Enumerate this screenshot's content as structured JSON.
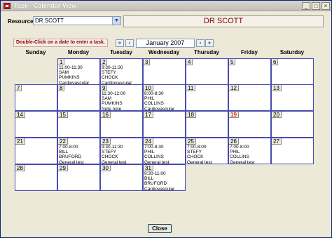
{
  "window": {
    "title": "Task - Calendar View"
  },
  "resource": {
    "label": "Resource:",
    "selected": "DR SCOTT",
    "display_name": "DR SCOTT"
  },
  "hint": "Double-Click on a date to enter a task.",
  "nav": {
    "first": "«",
    "prev": "‹",
    "month": "January 2007",
    "next": "›",
    "last": "»"
  },
  "weekdays": [
    "Sunday",
    "Monday",
    "Tuesday",
    "Wednesday",
    "Thursday",
    "Friday",
    "Saturday"
  ],
  "weeks": [
    [
      {
        "day": ""
      },
      {
        "day": "1",
        "lines": [
          "11:00-11:30",
          "SAM",
          "PUMKINS",
          "Cardiovascular"
        ]
      },
      {
        "day": "2",
        "lines": [
          "9:30-11:30",
          "STEFY",
          "CHOCK",
          "Cardiovascular"
        ]
      },
      {
        "day": "3"
      },
      {
        "day": "4"
      },
      {
        "day": "5"
      },
      {
        "day": "6"
      }
    ],
    [
      {
        "day": "7"
      },
      {
        "day": "8"
      },
      {
        "day": "9",
        "lines": [
          "11:30-12:00",
          "SAM",
          "PUMKINS",
          "Note note"
        ]
      },
      {
        "day": "10",
        "lines": [
          "8:00-8:30",
          "PHIL",
          "COLLINS",
          "Cardiovascular"
        ]
      },
      {
        "day": "11"
      },
      {
        "day": "12"
      },
      {
        "day": "13"
      }
    ],
    [
      {
        "day": "14"
      },
      {
        "day": "15"
      },
      {
        "day": "16"
      },
      {
        "day": "17"
      },
      {
        "day": "18"
      },
      {
        "day": "19",
        "holiday": true
      },
      {
        "day": "20"
      }
    ],
    [
      {
        "day": "21"
      },
      {
        "day": "22",
        "lines": [
          "7:00-8:00",
          "BILL",
          "BRUFORD",
          "General test"
        ]
      },
      {
        "day": "23",
        "lines": [
          "9:30-11:30",
          "STEFY",
          "CHOCK",
          "General test"
        ]
      },
      {
        "day": "24",
        "lines": [
          "7:00-8:30",
          "PHIL",
          "COLLINS",
          "General test"
        ]
      },
      {
        "day": "25",
        "lines": [
          "7:00-8:00",
          "STEFY",
          "CHOCK",
          "General test"
        ]
      },
      {
        "day": "26",
        "lines": [
          "7:00-8:00",
          "PHIL",
          "COLLINS",
          "General test"
        ]
      },
      {
        "day": "27"
      }
    ],
    [
      {
        "day": "28"
      },
      {
        "day": "29"
      },
      {
        "day": "30"
      },
      {
        "day": "31",
        "lines": [
          "9:30-11:00",
          "BILL",
          "BRUFORD",
          "Cardiovascular"
        ]
      }
    ]
  ],
  "close_label": "Close",
  "colors": {
    "title_text": "#ffffff",
    "doctor_text": "#800000",
    "cell_border": "#4a4ab5",
    "holiday": "#cc0000"
  }
}
